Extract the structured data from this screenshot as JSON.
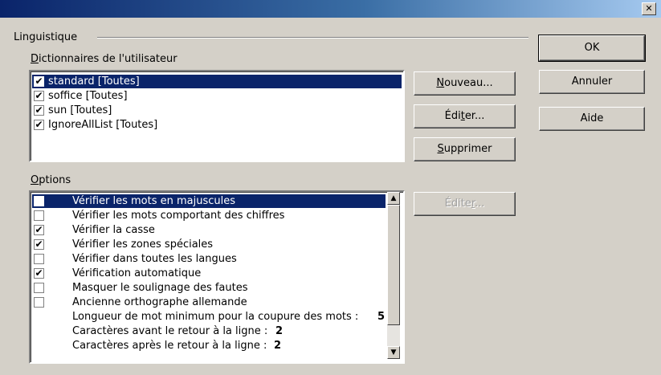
{
  "dialog": {
    "title": "",
    "close_glyph": "✕"
  },
  "linguistics": {
    "frame_label": "Linguistique",
    "dict_label_prefix": "D",
    "dict_label_rest": "ictionnaires de l'utilisateur",
    "dictionaries": [
      {
        "label": "standard [Toutes]",
        "checked": true,
        "selected": true
      },
      {
        "label": "soffice [Toutes]",
        "checked": true,
        "selected": false
      },
      {
        "label": "sun [Toutes]",
        "checked": true,
        "selected": false
      },
      {
        "label": "IgnoreAllList [Toutes]",
        "checked": true,
        "selected": false
      }
    ],
    "buttons": {
      "new_prefix": "N",
      "new_rest": "ouveau...",
      "edit_pre": "Édi",
      "edit_u": "t",
      "edit_post": "er...",
      "delete_prefix": "S",
      "delete_rest": "upprimer"
    },
    "options_label_prefix": "O",
    "options_label_rest": "ptions",
    "options": [
      {
        "label": "Vérifier les mots en majuscules",
        "checked": false,
        "has_checkbox": true,
        "selected": true
      },
      {
        "label": "Vérifier les mots comportant des chiffres",
        "checked": false,
        "has_checkbox": true
      },
      {
        "label": "Vérifier la casse",
        "checked": true,
        "has_checkbox": true
      },
      {
        "label": "Vérifier les zones spéciales",
        "checked": true,
        "has_checkbox": true
      },
      {
        "label": "Vérifier dans toutes les langues",
        "checked": false,
        "has_checkbox": true
      },
      {
        "label": "Vérification automatique",
        "checked": true,
        "has_checkbox": true
      },
      {
        "label": "Masquer le soulignage des fautes",
        "checked": false,
        "has_checkbox": true
      },
      {
        "label": "Ancienne orthographe allemande",
        "checked": false,
        "has_checkbox": true
      },
      {
        "label": "Longueur de mot minimum pour la coupure des mots :",
        "value": "5",
        "has_checkbox": false
      },
      {
        "label": "Caractères avant le retour à la ligne :",
        "value": "2",
        "has_checkbox": false
      },
      {
        "label": "Caractères après le retour à la ligne :",
        "value": "2",
        "has_checkbox": false
      }
    ],
    "options_edit_pre": "Édite",
    "options_edit_u": "r",
    "options_edit_post": "..."
  },
  "side_buttons": {
    "ok": "OK",
    "cancel": "Annuler",
    "help": "Aide"
  },
  "icons": {
    "check": "✔",
    "scroll_up": "▲",
    "scroll_down": "▼"
  }
}
